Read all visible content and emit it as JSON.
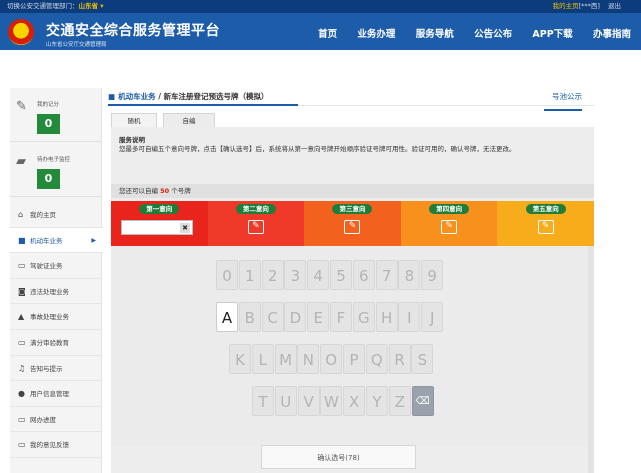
{
  "topbar": {
    "switch_label": "切换公安交通管理部门：",
    "province": "山东省",
    "my_home": "我的主页",
    "my_home_suffix": "[***西]",
    "logout": "退出"
  },
  "header": {
    "title": "交通安全综合服务管理平台",
    "subtitle": "山东省公安厅交通管理局",
    "nav": [
      "首页",
      "业务办理",
      "服务导航",
      "公告公布",
      "APP下载",
      "办事指南"
    ]
  },
  "sidebar": {
    "score": {
      "label": "我的记分",
      "value": "0"
    },
    "monitor": {
      "label": "待办电子监控",
      "value": "0"
    },
    "menu": [
      {
        "label": "我的主页",
        "icon": "home-icon",
        "glyph": "⌂"
      },
      {
        "label": "机动车业务",
        "icon": "truck-icon",
        "glyph": "■",
        "active": true
      },
      {
        "label": "驾驶证业务",
        "icon": "card-icon",
        "glyph": "▭"
      },
      {
        "label": "违法处理业务",
        "icon": "camera-icon",
        "glyph": "◙"
      },
      {
        "label": "事故处理业务",
        "icon": "warning-icon",
        "glyph": "▲"
      },
      {
        "label": "满分审验教育",
        "icon": "monitor-icon",
        "glyph": "▭"
      },
      {
        "label": "告知与提示",
        "icon": "bell-icon",
        "glyph": "♫"
      },
      {
        "label": "用户信息管理",
        "icon": "user-icon",
        "glyph": "●"
      },
      {
        "label": "网办进度",
        "icon": "progress-icon",
        "glyph": "▭"
      },
      {
        "label": "我的意见反馈",
        "icon": "feedback-icon",
        "glyph": "▭"
      }
    ]
  },
  "breadcrumb": {
    "module": "机动车业务",
    "separator": " / ",
    "page": "新车注册登记预选号牌（模拟）"
  },
  "pool_link": "号池公示",
  "tabs": [
    "随机",
    "自编"
  ],
  "notice": {
    "title": "服务说明",
    "body": "您最多可自编五个意向号牌，点击【确认选号】后，系统将从第一意向号牌开始顺序验证号牌可用性。验证可用的，确认号牌，无法更改。"
  },
  "remain": {
    "prefix": "您还可以自编 ",
    "count": "50",
    "suffix": " 个号牌"
  },
  "directions": [
    {
      "label": "第一意向",
      "color": "#e8241c"
    },
    {
      "label": "第二意向",
      "color": "#ef3a2a"
    },
    {
      "label": "第三意向",
      "color": "#f3611f"
    },
    {
      "label": "第四意向",
      "color": "#f7901d"
    },
    {
      "label": "第五意向",
      "color": "#f6ac1b"
    }
  ],
  "keyboard": {
    "row1": [
      "0",
      "1",
      "2",
      "3",
      "4",
      "5",
      "6",
      "7",
      "8",
      "9"
    ],
    "row2": [
      "A",
      "B",
      "C",
      "D",
      "E",
      "F",
      "G",
      "H",
      "I",
      "J"
    ],
    "row3": [
      "K",
      "L",
      "M",
      "N",
      "O",
      "P",
      "Q",
      "R",
      "S"
    ],
    "row4": [
      "T",
      "U",
      "V",
      "W",
      "X",
      "Y",
      "Z"
    ],
    "selected_key": "A",
    "delete_glyph": "⌫"
  },
  "confirm_button": "确认选号(78)"
}
